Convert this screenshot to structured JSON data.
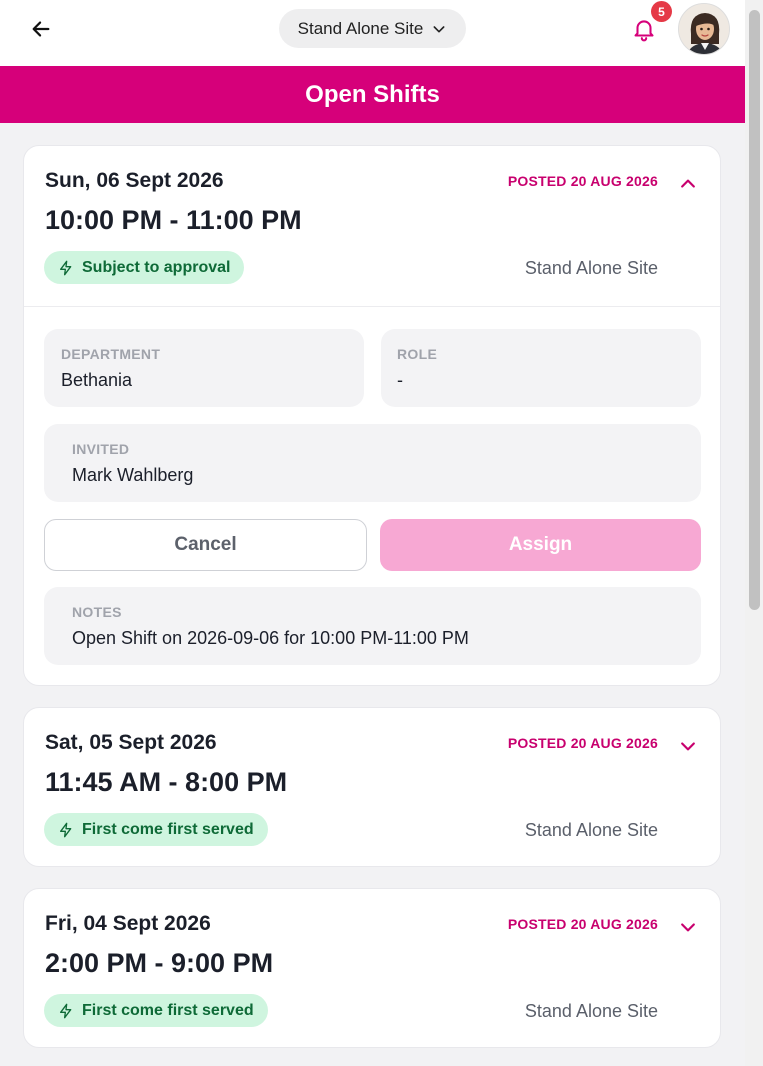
{
  "header": {
    "site_selector": "Stand Alone Site",
    "notification_count": "5"
  },
  "banner": {
    "title": "Open Shifts"
  },
  "shifts": [
    {
      "date": "Sun, 06 Sept 2026",
      "time": "10:00 PM - 11:00 PM",
      "posted": "POSTED 20 AUG 2026",
      "tag": "Subject to approval",
      "site": "Stand Alone Site",
      "expanded": true,
      "details": {
        "department_label": "DEPARTMENT",
        "department_value": "Bethania",
        "role_label": "ROLE",
        "role_value": "-",
        "invited_label": "INVITED",
        "invited_value": "Mark Wahlberg",
        "cancel_label": "Cancel",
        "assign_label": "Assign",
        "notes_label": "NOTES",
        "notes_value": "Open Shift on 2026-09-06 for 10:00 PM-11:00 PM"
      }
    },
    {
      "date": "Sat, 05 Sept 2026",
      "time": "11:45 AM - 8:00 PM",
      "posted": "POSTED 20 AUG 2026",
      "tag": "First come first served",
      "site": "Stand Alone Site",
      "expanded": false
    },
    {
      "date": "Fri, 04 Sept 2026",
      "time": "2:00 PM - 9:00 PM",
      "posted": "POSTED 20 AUG 2026",
      "tag": "First come first served",
      "site": "Stand Alone Site",
      "expanded": false
    }
  ],
  "colors": {
    "brand": "#d6007a",
    "posted": "#c8006e",
    "tag_bg": "#cff5df",
    "tag_text": "#0e6a37",
    "assign_disabled": "#f7a8d3",
    "badge": "#e53946"
  },
  "icons": {
    "back": "arrow-left-icon",
    "dropdown": "chevron-down-icon",
    "notifications": "bell-icon",
    "collapse": "chevron-up-icon",
    "expand": "chevron-down-icon",
    "tag": "lightning-icon"
  }
}
